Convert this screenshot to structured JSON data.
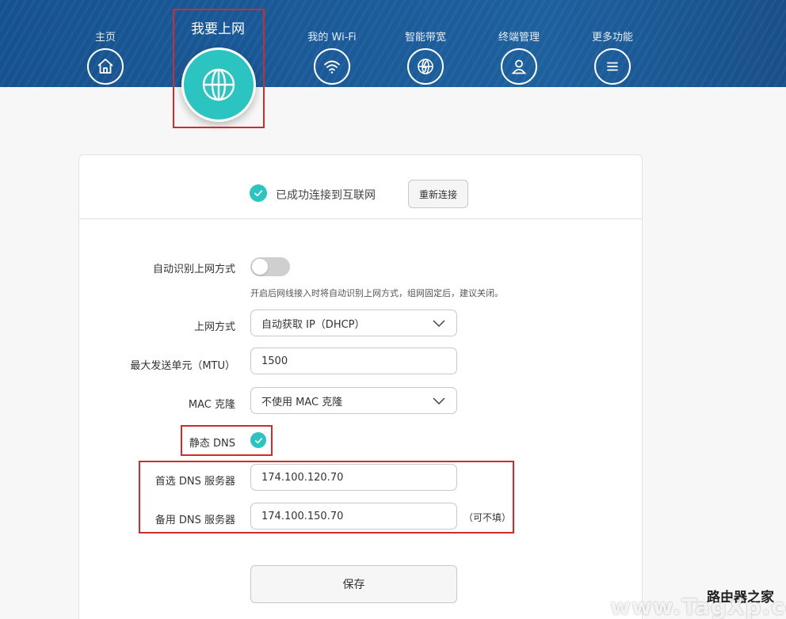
{
  "nav": {
    "items": [
      {
        "label": "主页",
        "icon": "home-icon"
      },
      {
        "label": "我要上网",
        "icon": "globe-icon",
        "active": true
      },
      {
        "label": "我的 Wi-Fi",
        "icon": "wifi-icon"
      },
      {
        "label": "智能带宽",
        "icon": "bandwidth-icon"
      },
      {
        "label": "终端管理",
        "icon": "user-icon"
      },
      {
        "label": "更多功能",
        "icon": "menu-icon"
      }
    ]
  },
  "status": {
    "text": "已成功连接到互联网",
    "reconnect_label": "重新连接"
  },
  "form": {
    "auto_detect": {
      "label": "自动识别上网方式",
      "enabled": false,
      "hint": "开启后网线接入时将自动识别上网方式，组网固定后，建议关闭。"
    },
    "connection_type": {
      "label": "上网方式",
      "value": "自动获取 IP（DHCP）"
    },
    "mtu": {
      "label": "最大发送单元（MTU）",
      "value": "1500"
    },
    "mac_clone": {
      "label": "MAC 克隆",
      "value": "不使用 MAC 克隆"
    },
    "static_dns": {
      "label": "静态 DNS",
      "checked": true
    },
    "primary_dns": {
      "label": "首选 DNS 服务器",
      "value": "174.100.120.70"
    },
    "secondary_dns": {
      "label": "备用 DNS 服务器",
      "value": "174.100.150.70",
      "optional_note": "（可不填）"
    },
    "save_label": "保存"
  },
  "watermark": {
    "cn": "路由器之家",
    "en": "www.TagXp.com"
  },
  "colors": {
    "header": "#1a5a98",
    "accent": "#2cc4c0",
    "highlight_box": "#d22b2b"
  }
}
